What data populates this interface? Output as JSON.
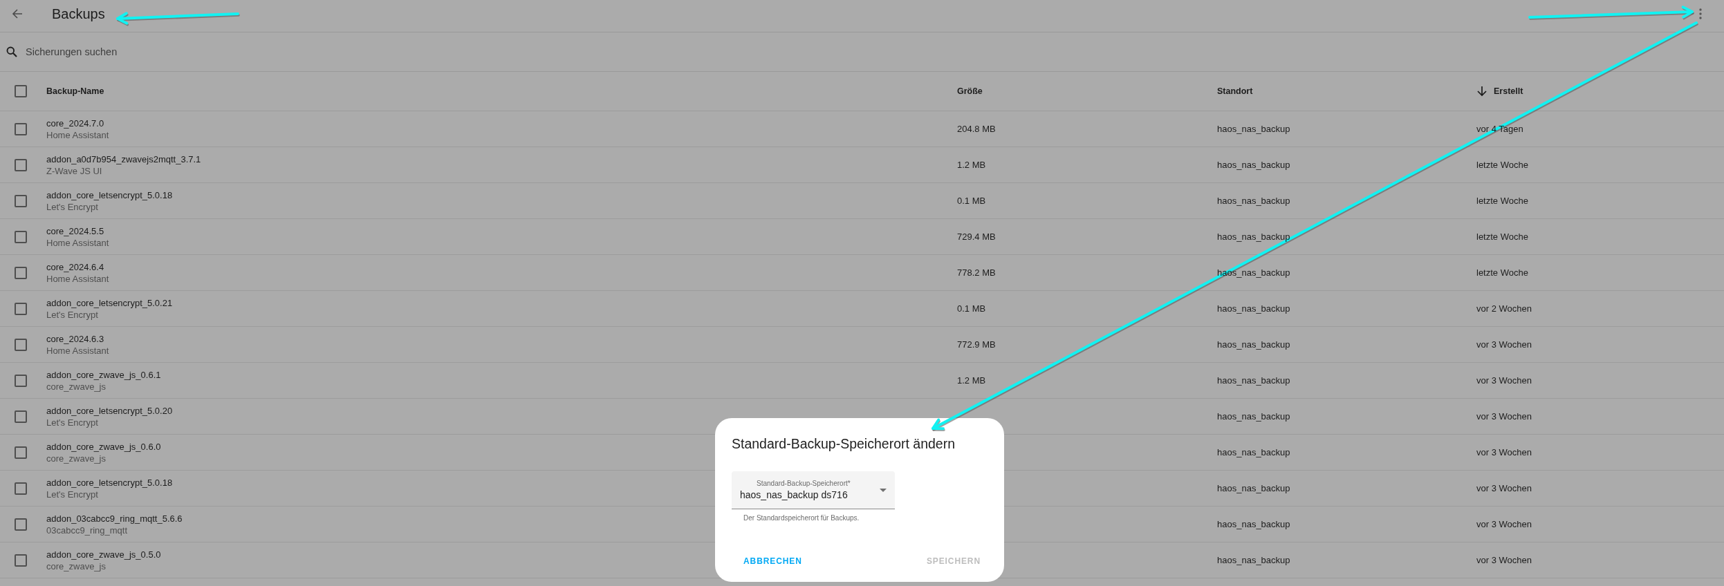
{
  "app_bar": {
    "title": "Backups"
  },
  "search": {
    "placeholder": "Sicherungen suchen"
  },
  "table": {
    "select_all": {
      "checked": false
    },
    "columns": [
      {
        "label": "Backup-Name",
        "sorted": false
      },
      {
        "label": "Größe",
        "sorted": false
      },
      {
        "label": "Standort",
        "sorted": false
      },
      {
        "label": "Erstellt",
        "sorted": true
      }
    ],
    "rows": [
      {
        "checked": false,
        "name": "core_2024.7.0",
        "source": "Home Assistant",
        "size": "204.8 MB",
        "location": "haos_nas_backup",
        "created": "vor 4 Tagen"
      },
      {
        "checked": false,
        "name": "addon_a0d7b954_zwavejs2mqtt_3.7.1",
        "source": "Z-Wave JS UI",
        "size": "1.2 MB",
        "location": "haos_nas_backup",
        "created": "letzte Woche"
      },
      {
        "checked": false,
        "name": "addon_core_letsencrypt_5.0.18",
        "source": "Let's Encrypt",
        "size": "0.1 MB",
        "location": "haos_nas_backup",
        "created": "letzte Woche"
      },
      {
        "checked": false,
        "name": "core_2024.5.5",
        "source": "Home Assistant",
        "size": "729.4 MB",
        "location": "haos_nas_backup",
        "created": "letzte Woche"
      },
      {
        "checked": false,
        "name": "core_2024.6.4",
        "source": "Home Assistant",
        "size": "778.2 MB",
        "location": "haos_nas_backup",
        "created": "letzte Woche"
      },
      {
        "checked": false,
        "name": "addon_core_letsencrypt_5.0.21",
        "source": "Let's Encrypt",
        "size": "0.1 MB",
        "location": "haos_nas_backup",
        "created": "vor 2 Wochen"
      },
      {
        "checked": false,
        "name": "core_2024.6.3",
        "source": "Home Assistant",
        "size": "772.9 MB",
        "location": "haos_nas_backup",
        "created": "vor 3 Wochen"
      },
      {
        "checked": false,
        "name": "addon_core_zwave_js_0.6.1",
        "source": "core_zwave_js",
        "size": "1.2 MB",
        "location": "haos_nas_backup",
        "created": "vor 3 Wochen"
      },
      {
        "checked": false,
        "name": "addon_core_letsencrypt_5.0.20",
        "source": "Let's Encrypt",
        "location": "haos_nas_backup",
        "created": "vor 3 Wochen"
      },
      {
        "checked": false,
        "name": "addon_core_zwave_js_0.6.0",
        "source": "core_zwave_js",
        "location": "haos_nas_backup",
        "created": "vor 3 Wochen"
      },
      {
        "checked": false,
        "name": "addon_core_letsencrypt_5.0.18",
        "source": "Let's Encrypt",
        "location": "haos_nas_backup",
        "created": "vor 3 Wochen"
      },
      {
        "checked": false,
        "name": "addon_03cabcc9_ring_mqtt_5.6.6",
        "source": "03cabcc9_ring_mqtt",
        "location": "haos_nas_backup",
        "created": "vor 3 Wochen"
      },
      {
        "checked": false,
        "name": "addon_core_zwave_js_0.5.0",
        "source": "core_zwave_js",
        "location": "haos_nas_backup",
        "created": "vor 3 Wochen"
      }
    ]
  },
  "dialog": {
    "title": "Standard-Backup-Speicherort ändern",
    "select": {
      "label": "Standard-Backup-Speicherort*",
      "value": "haos_nas_backup ds716",
      "helper": "Der Standardspeicherort für Backups."
    },
    "buttons": [
      {
        "label": "ABBRECHEN",
        "disabled": false
      },
      {
        "label": "SPEICHERN",
        "disabled": true
      }
    ]
  }
}
